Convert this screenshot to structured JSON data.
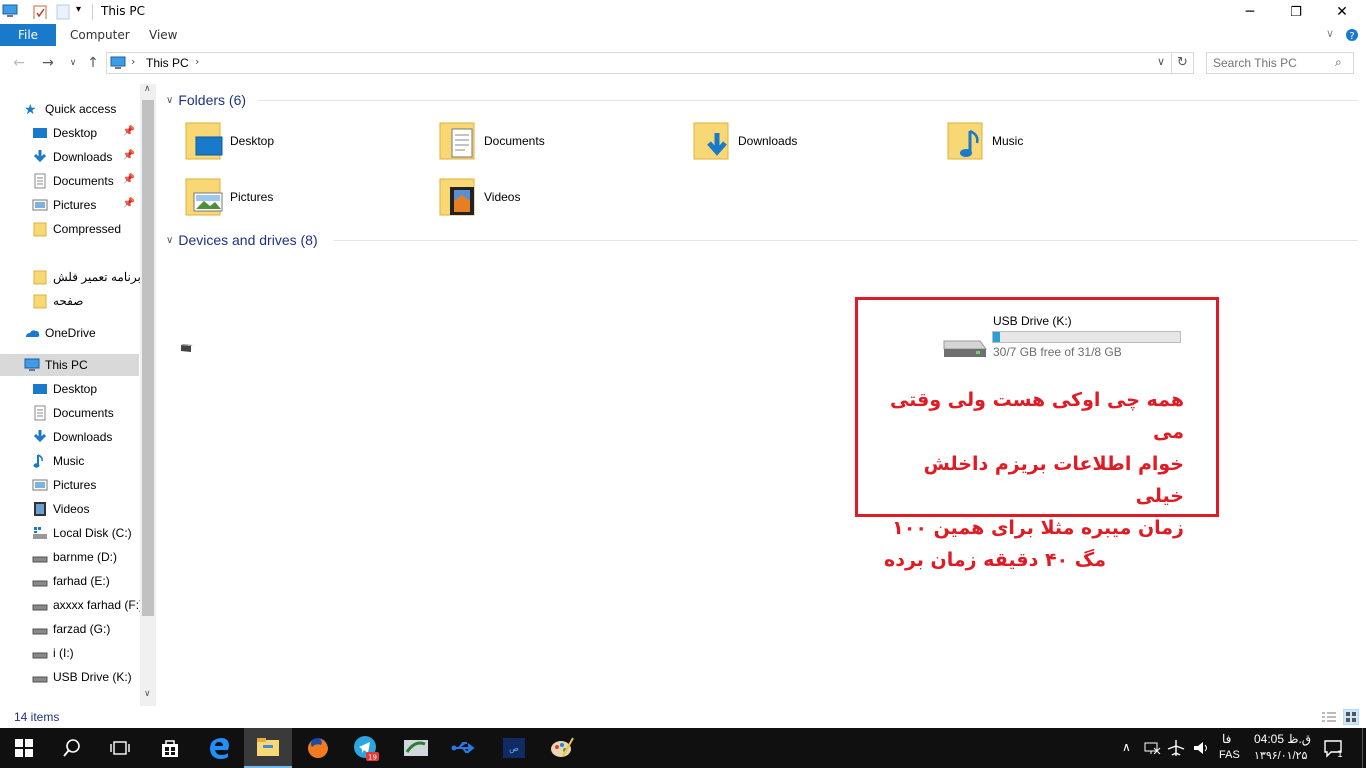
{
  "window": {
    "title": "This PC",
    "minimize": "─",
    "restore": "❐",
    "close": "✕"
  },
  "ribbon": {
    "tabs": [
      "File",
      "Computer",
      "View"
    ]
  },
  "address": {
    "crumb": "This PC",
    "search_placeholder": "Search This PC"
  },
  "nav": {
    "quick_access": "Quick access",
    "quick_items": [
      "Desktop",
      "Downloads",
      "Documents",
      "Pictures",
      "Compressed"
    ],
    "persian_items": [
      "برنامه تعمیر فلش",
      "صفحه"
    ],
    "onedrive": "OneDrive",
    "this_pc": "This PC",
    "pc_items": [
      "Desktop",
      "Documents",
      "Downloads",
      "Music",
      "Pictures",
      "Videos",
      "Local Disk (C:)",
      "barnme (D:)",
      "farhad (E:)",
      "axxxx farhad (F:)",
      "farzad (G:)",
      "i (I:)",
      "USB Drive (K:)"
    ]
  },
  "content": {
    "folders_header": "Folders (6)",
    "folders": [
      "Desktop",
      "Documents",
      "Downloads",
      "Music",
      "Pictures",
      "Videos"
    ],
    "devices_header": "Devices and drives (8)",
    "drive": {
      "name": "USB Drive (K:)",
      "free_text": "30/7 GB free of 31/8 GB",
      "used_fraction": 0.035,
      "bar_color": "#26a0da"
    }
  },
  "annotation": {
    "lines": [
      "همه چی اوکی هست ولی وقتی می",
      "خوام اطلاعات بریزم داخلش خیلی",
      "زمان میبره مثلا برای همین ۱۰۰",
      "مگ ۴۰ دقیقه زمان برده"
    ],
    "color": "#e01b24"
  },
  "status": {
    "items_count": "14 items"
  },
  "taskbar": {
    "notification_badge": "19",
    "tray_lang_top": "فا",
    "tray_lang_bottom": "FAS",
    "time": "04:05 ق.ظ",
    "date": "۱۳۹۶/۰۱/۲۵",
    "notifications_count": "1"
  }
}
